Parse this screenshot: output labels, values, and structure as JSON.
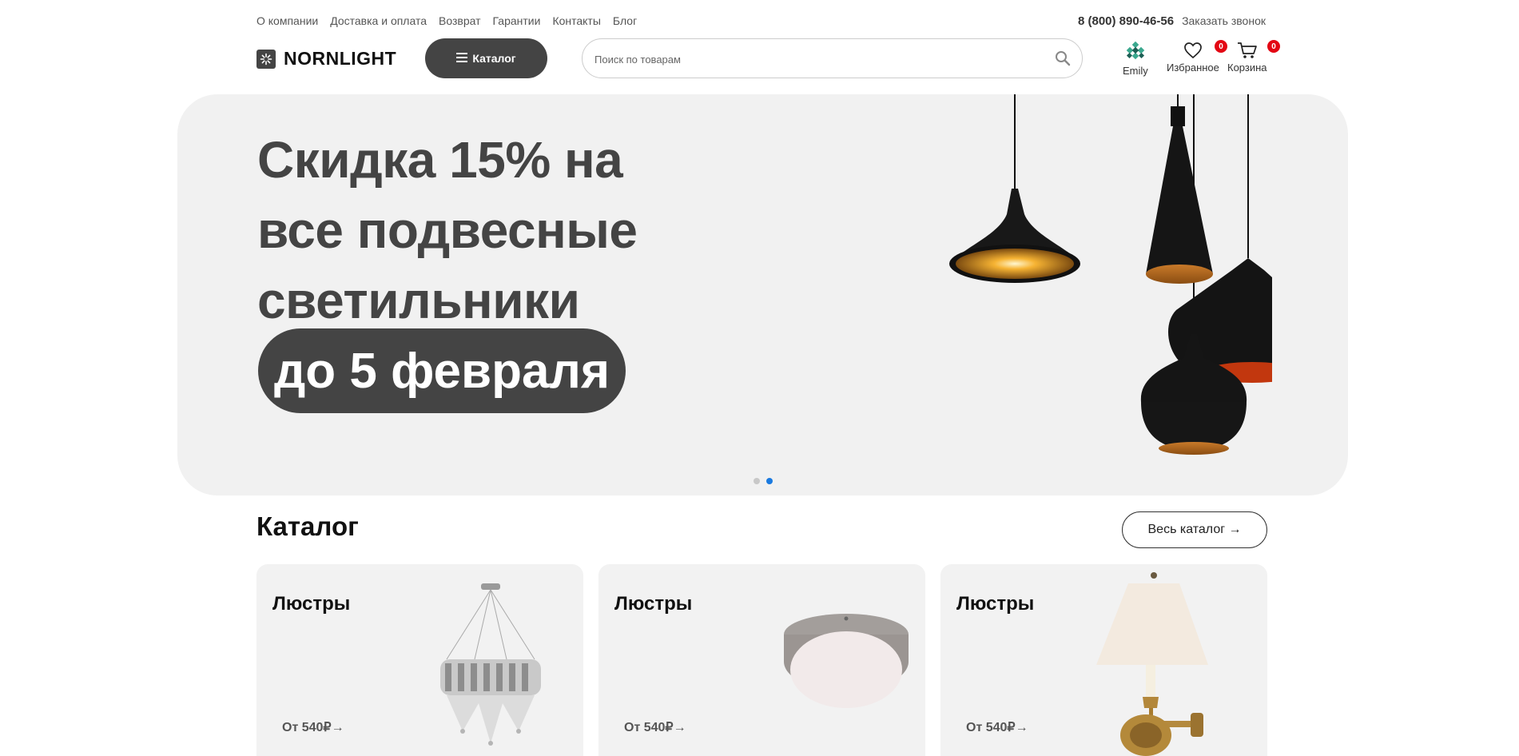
{
  "topnav": {
    "links": [
      "О компании",
      "Доставка и оплата",
      "Возврат",
      "Гарантии",
      "Контакты",
      "Блог"
    ],
    "phone": "8 (800) 890-46-56",
    "callback": "Заказать звонок"
  },
  "header": {
    "logo": "NORNLIGHT",
    "catalog_label": "Каталог",
    "search_placeholder": "Поиск по товарам",
    "user_name": "Emily",
    "favorites_label": "Избранное",
    "favorites_count": "0",
    "cart_label": "Корзина",
    "cart_count": "0"
  },
  "banner": {
    "line1": "Скидка 15% на",
    "line2": "все подвесные",
    "line3": "светильники",
    "highlight": "до 5 февраля",
    "slides": 2,
    "active_slide": 2,
    "accent_color": "#1a7ae0"
  },
  "catalog": {
    "title": "Каталог",
    "all_button": "Весь каталог →",
    "cards": [
      {
        "title": "Люстры",
        "price": "От 540₽→",
        "image": "crystal-chandelier"
      },
      {
        "title": "Люстры",
        "price": "От 540₽→",
        "image": "ceiling-lamp"
      },
      {
        "title": "Люстры",
        "price": "От 540₽→",
        "image": "wall-sconce"
      }
    ]
  }
}
